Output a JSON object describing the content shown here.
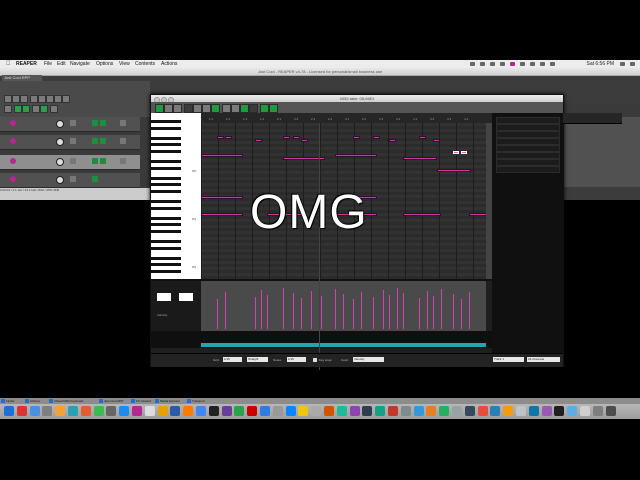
{
  "menubar": {
    "app_name": "REAPER",
    "items": [
      "File",
      "Edit",
      "Navigate",
      "Options",
      "View",
      "Contents",
      "Actions"
    ],
    "clock": "Sat 6:56 PM"
  },
  "reaper_window": {
    "title": "Just Cool - REAPER v4.78 - Licensed for personal/small business use",
    "project_tab": "Just Cool.RPP",
    "status_text": "2:00:03 / 1.1 slot / 44.1 kHz 16bit / 45% 3KB"
  },
  "midi_editor": {
    "title": "MIDI take: 05-MIDI",
    "ruler_ticks": [
      "1.1",
      "1.2",
      "1.3",
      "1.4",
      "2.1",
      "2.2",
      "2.3",
      "2.4",
      "3.1",
      "3.2",
      "3.3",
      "3.4",
      "4.1",
      "4.2",
      "4.3",
      "4.4"
    ],
    "octave_labels": [
      "C5",
      "C4",
      "C3"
    ],
    "cc_lane_label": "Velocity",
    "footer": {
      "grid_label": "Grid:",
      "grid_value": "1/16",
      "notes_label": "Notes:",
      "notes_value": "1/16",
      "straight_value": "Straight",
      "key_snap_label": "Key snap",
      "color_label": "Color:",
      "color_value": "Velocity"
    },
    "key_panel": {
      "track_select": "Track 1",
      "channel_select": "All channels"
    }
  },
  "overlay_text": "OMG",
  "taskbar": {
    "items": [
      "Finder",
      "Actions",
      "Virtual MIDI Keyboard",
      "Just Cool.RPP",
      "FX: Roland",
      "Media Explorer",
      "Transport"
    ]
  },
  "colors": {
    "note": "#c83aa0",
    "note_selected": "#f35cd2",
    "accent_green": "#1c9c3f",
    "scroll_cyan": "#2aa0b4"
  }
}
